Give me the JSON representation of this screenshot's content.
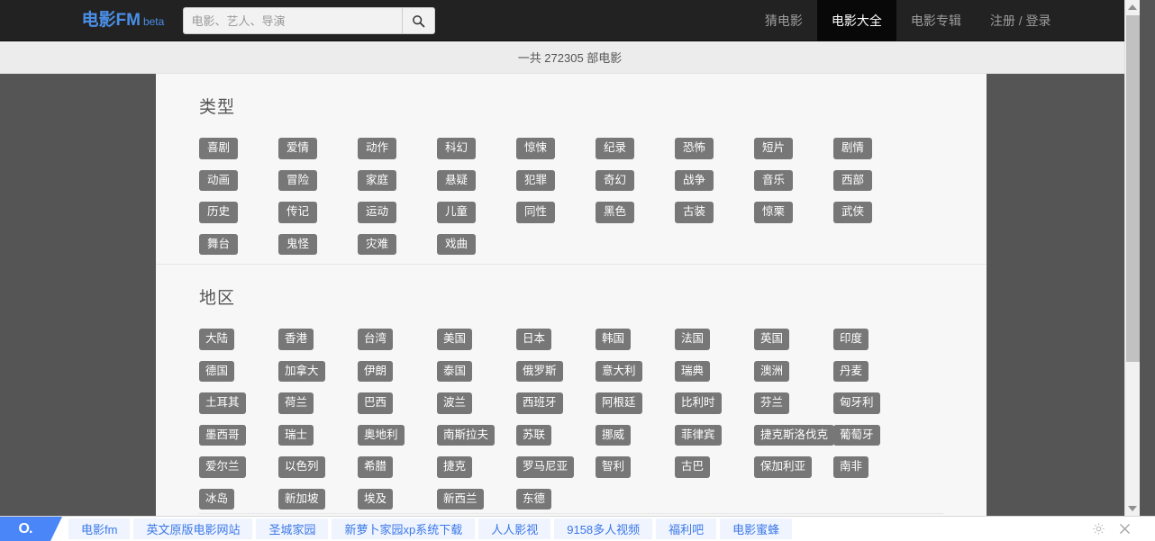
{
  "navbar": {
    "brand": "电影FM",
    "brand_beta": "beta",
    "search": {
      "placeholder": "电影、艺人、导演",
      "value": "",
      "button_icon": "search-icon"
    },
    "menu": [
      {
        "label": "猜电影",
        "active": false
      },
      {
        "label": "电影大全",
        "active": true
      },
      {
        "label": "电影专辑",
        "active": false
      },
      {
        "label": "注册 / 登录",
        "active": false
      }
    ],
    "accent_color": "#4a8fe7",
    "background_color": "#222222"
  },
  "subbar": {
    "text": "一共 272305 部电影",
    "count": 272305,
    "background_color": "#ececec"
  },
  "sections": [
    {
      "title": "类型",
      "name": "genre",
      "tags": [
        "喜剧",
        "爱情",
        "动作",
        "科幻",
        "惊悚",
        "纪录",
        "恐怖",
        "短片",
        "剧情",
        "动画",
        "冒险",
        "家庭",
        "悬疑",
        "犯罪",
        "奇幻",
        "战争",
        "音乐",
        "西部",
        "历史",
        "传记",
        "运动",
        "儿童",
        "同性",
        "黑色",
        "古装",
        "惊栗",
        "武侠",
        "舞台",
        "鬼怪",
        "灾难",
        "戏曲"
      ]
    },
    {
      "title": "地区",
      "name": "region",
      "tags": [
        "大陆",
        "香港",
        "台湾",
        "美国",
        "日本",
        "韩国",
        "法国",
        "英国",
        "印度",
        "德国",
        "加拿大",
        "伊朗",
        "泰国",
        "俄罗斯",
        "意大利",
        "瑞典",
        "澳洲",
        "丹麦",
        "土耳其",
        "荷兰",
        "巴西",
        "波兰",
        "西班牙",
        "阿根廷",
        "比利时",
        "芬兰",
        "匈牙利",
        "墨西哥",
        "瑞士",
        "奥地利",
        "南斯拉夫",
        "苏联",
        "挪威",
        "菲律宾",
        "捷克斯洛伐克",
        "葡萄牙",
        "爱尔兰",
        "以色列",
        "希腊",
        "捷克",
        "罗马尼亚",
        "智利",
        "古巴",
        "保加利亚",
        "南非",
        "冰岛",
        "新加坡",
        "埃及",
        "新西兰",
        "东德"
      ]
    }
  ],
  "tag_style": {
    "background_color": "#777777",
    "text_color": "#ffffff"
  },
  "scrollbar": {
    "up_icon": "triangle-up-icon",
    "down_icon": "triangle-down-icon",
    "thumb_color": "#c1c1c1"
  },
  "taskbar": {
    "start_label": "O.",
    "links": [
      "电影fm",
      "英文原版电影网站",
      "圣城家园",
      "新萝卜家园xp系统下载",
      "人人影视",
      "9158多人视频",
      "福利吧",
      "电影蜜蜂"
    ],
    "right_icons": [
      {
        "name": "gear-icon"
      },
      {
        "name": "close-icon"
      }
    ],
    "link_color": "#3b78e7",
    "start_color": "#4a86f7"
  }
}
